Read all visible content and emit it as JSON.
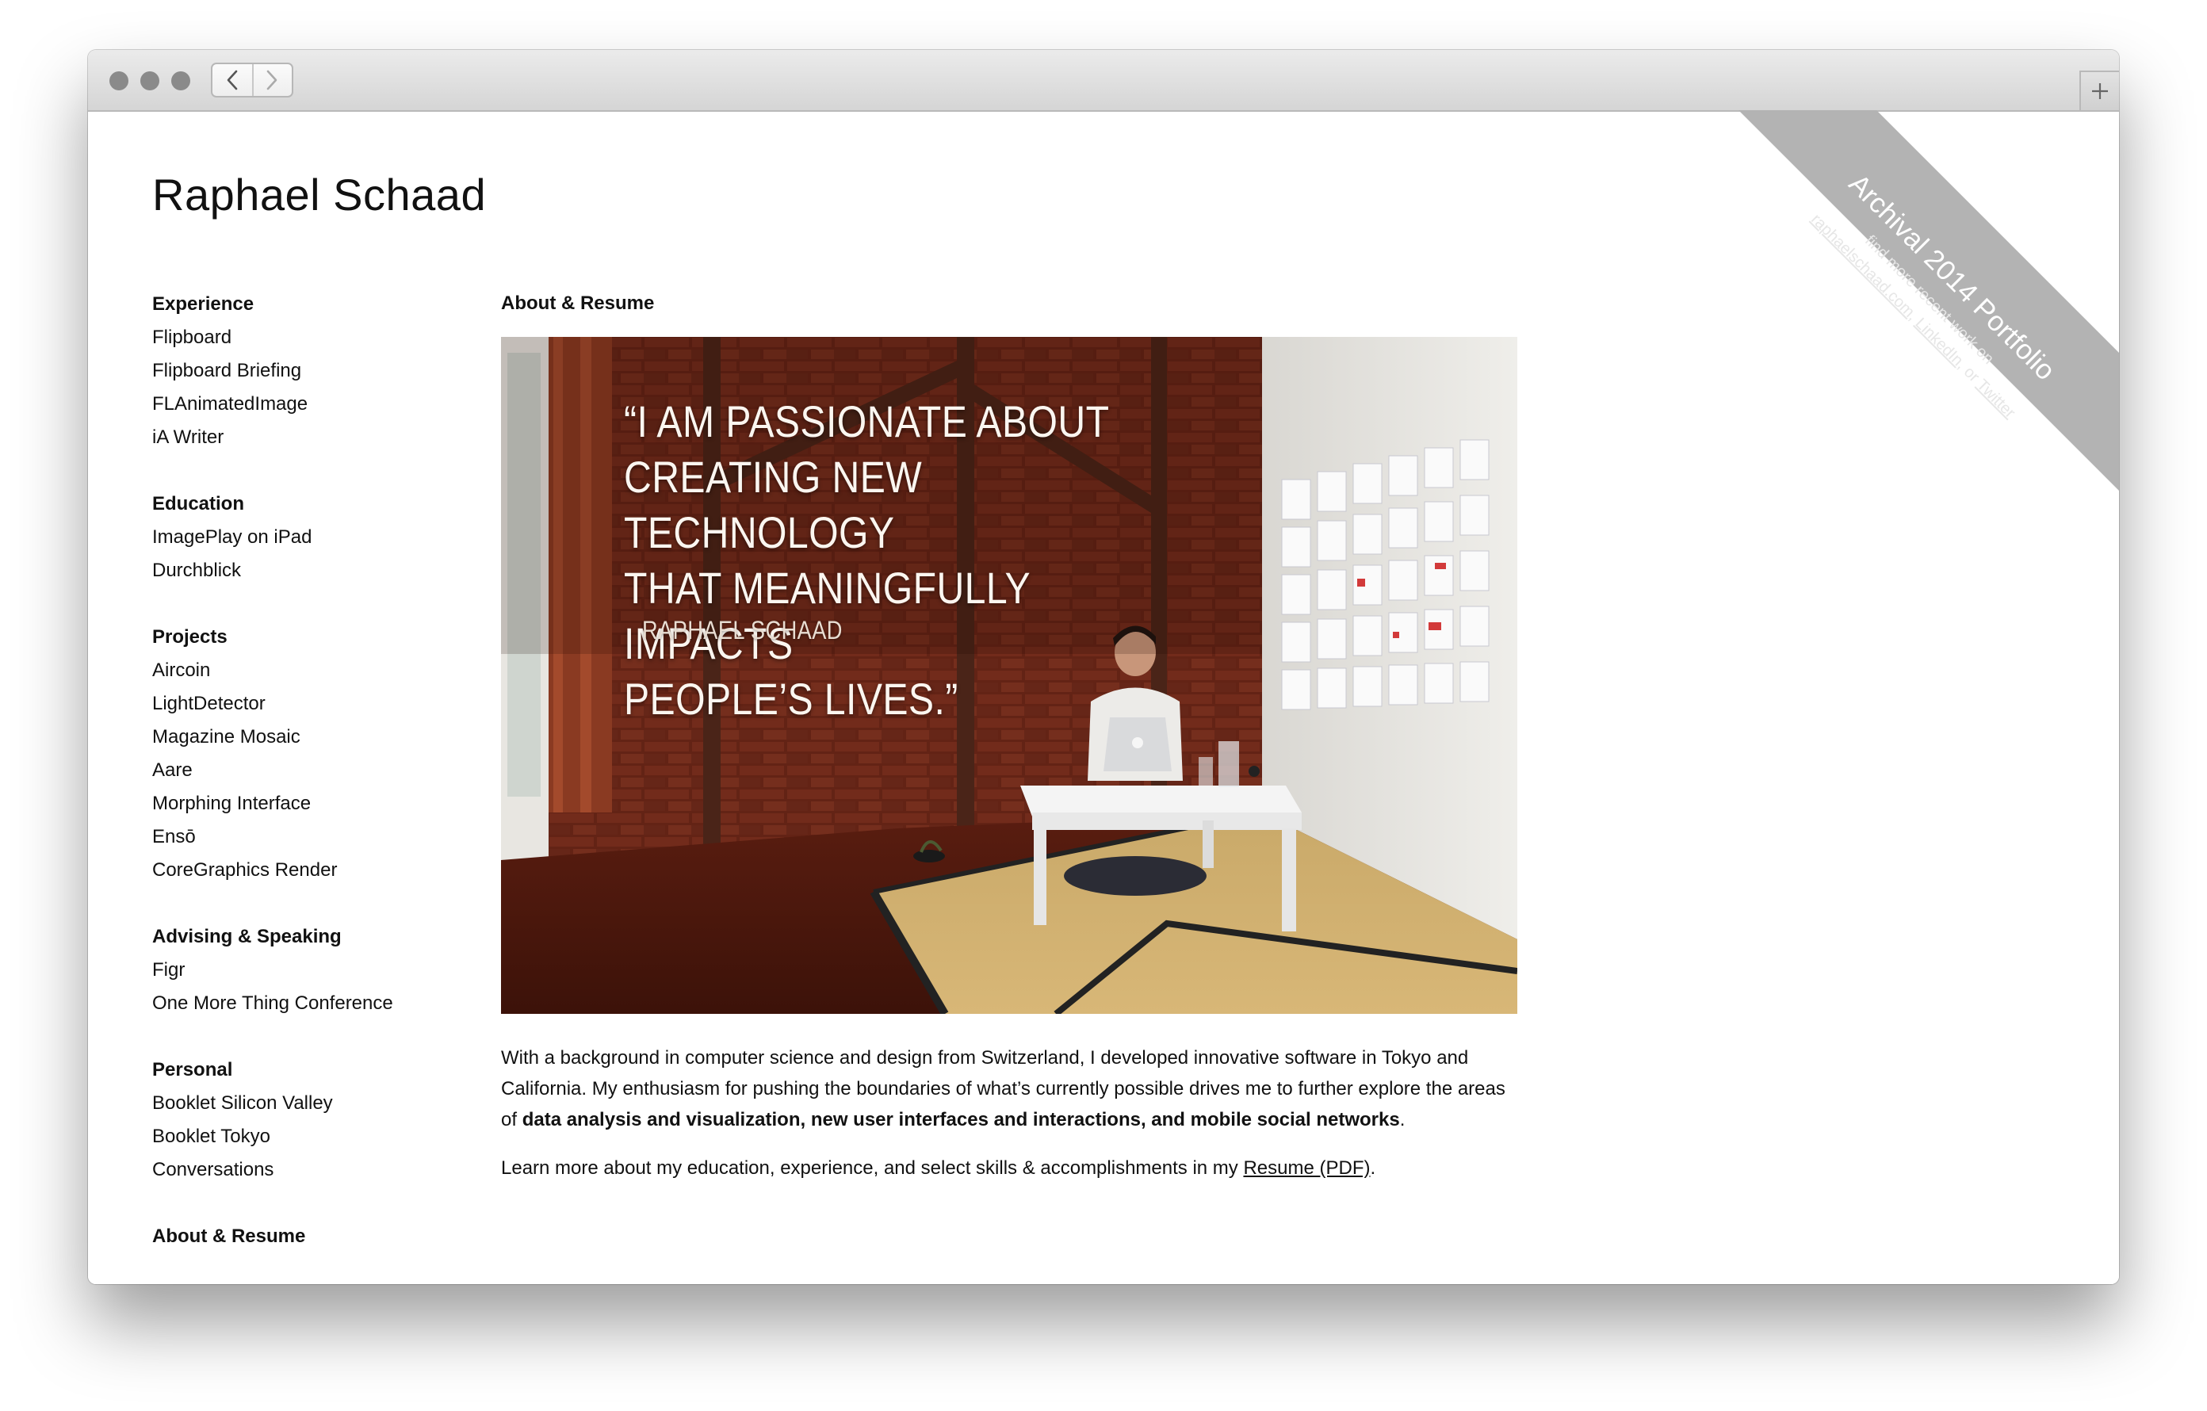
{
  "window": {
    "traffic_lights": [
      "close",
      "minimize",
      "zoom"
    ],
    "nav": {
      "back_icon": "chevron-left-icon",
      "forward_icon": "chevron-right-icon"
    },
    "new_tab_icon": "plus-icon"
  },
  "site": {
    "title": "Raphael Schaad"
  },
  "sidebar": {
    "groups": [
      {
        "heading": "Experience",
        "items": [
          "Flipboard",
          "Flipboard Briefing",
          "FLAnimatedImage",
          "iA Writer"
        ]
      },
      {
        "heading": "Education",
        "items": [
          "ImagePlay on iPad",
          "Durchblick"
        ]
      },
      {
        "heading": "Projects",
        "items": [
          "Aircoin",
          "LightDetector",
          "Magazine Mosaic",
          "Aare",
          "Morphing Interface",
          "Ensō",
          "CoreGraphics Render"
        ]
      },
      {
        "heading": "Advising & Speaking",
        "items": [
          "Figr",
          "One More Thing Conference"
        ]
      },
      {
        "heading": "Personal",
        "items": [
          "Booklet Silicon Valley",
          "Booklet Tokyo",
          "Conversations"
        ]
      },
      {
        "heading": "About & Resume",
        "items": []
      }
    ]
  },
  "main": {
    "heading": "About & Resume",
    "hero": {
      "quote": "“I AM PASSIONATE ABOUT\n CREATING NEW TECHNOLOGY\n THAT MEANINGFULLY IMPACTS\n PEOPLE’S LIVES.”",
      "attribution": "RAPHAEL SCHAAD"
    },
    "paragraph1": {
      "pre": "With a background in computer science and design from Switzerland, I developed innovative software in Tokyo and California. My enthusiasm for pushing the boundaries of what’s currently possible drives me to further explore the areas of ",
      "bold": "data analysis and visualization, new user interfaces and interactions, and mobile social networks",
      "post": "."
    },
    "paragraph2": {
      "pre": "Learn more about my education, experience, and select skills & accomplishments in my ",
      "link": "Resume (PDF)",
      "post": "."
    }
  },
  "ribbon": {
    "title": "Archival 2014 Portfolio",
    "line1": "find more recent work on",
    "links": [
      "raphaelschaad.com",
      "LinkedIn",
      "Twitter"
    ],
    "sep1": ", ",
    "sep2": ", or "
  },
  "colors": {
    "ribbon": "#b3b3b3",
    "text": "#111111",
    "chrome": "#d8d8d8"
  }
}
